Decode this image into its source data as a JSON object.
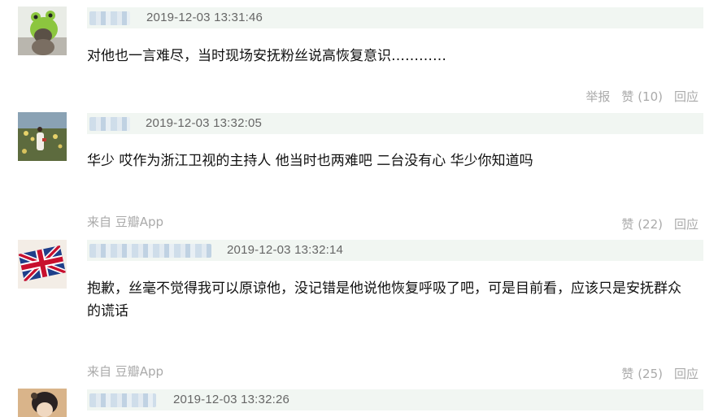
{
  "comments": [
    {
      "timestamp": "2019-12-03 13:31:46",
      "text": "对他也一言难尽，当时现场安抚粉丝说高恢复意识…………",
      "report_label": "举报",
      "like_label": "赞",
      "like_count": "(10)",
      "reply_label": "回应",
      "avatar": "green-frog-hat-cat-avatar"
    },
    {
      "timestamp": "2019-12-03 13:32:05",
      "text": "华少 哎作为浙江卫视的主持人 他当时也两难吧 二台没有心 华少你知道吗",
      "source": "来自 豆瓣App",
      "like_label": "赞",
      "like_count": "(22)",
      "reply_label": "回应",
      "avatar": "meadow-girl-avatar"
    },
    {
      "timestamp": "2019-12-03 13:32:14",
      "text": "抱歉，丝毫不觉得我可以原谅他，没记错是他说他恢复呼吸了吧，可是目前看，应该只是安抚群众的谎话",
      "source": "来自 豆瓣App",
      "like_label": "赞",
      "like_count": "(25)",
      "reply_label": "回应",
      "avatar": "union-jack-avatar"
    },
    {
      "timestamp": "2019-12-03 13:32:26",
      "avatar": "dark-hair-person-avatar"
    }
  ],
  "colors": {
    "header_bg": "#f1f6f2",
    "meta_text": "#aaaaaa",
    "timestamp_text": "#666666"
  }
}
